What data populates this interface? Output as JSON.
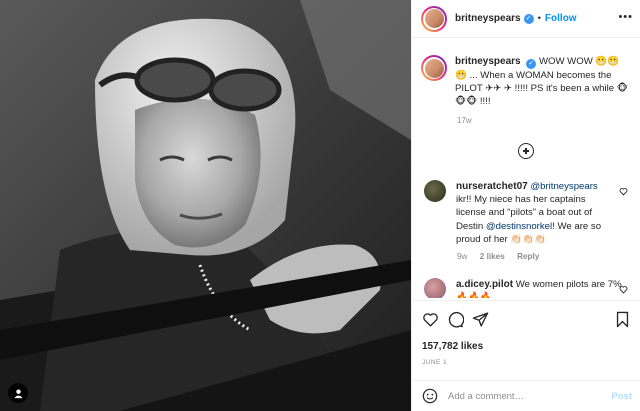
{
  "photo": {
    "alt_icon": "person-tag-icon"
  },
  "header": {
    "username": "britneyspears",
    "verified_glyph": "✓",
    "separator": "•",
    "follow_label": "Follow",
    "more_glyph": "•••"
  },
  "caption": {
    "username": "britneyspears",
    "text": "WOW WOW 😬😬😬 ... When a WOMAN becomes the PILOT ✈✈ ✈ !!!!! PS it's been a while 🐵🐵🐵 !!!!",
    "time": "17w"
  },
  "comments": [
    {
      "username": "nurseratchet07",
      "mention1": "@britneyspears",
      "text1": "ikr!! My niece has her captains license and “pilots” a boat out of Destin",
      "mention2": "@destinsnorkel",
      "text2": "! We are so proud of her 👏🏻👏🏻👏🏻",
      "time": "9w",
      "likes": "2 likes",
      "reply": "Reply"
    },
    {
      "username": "a.dicey.pilot",
      "text": "We women pilots are 7% 🔥🔥🔥"
    }
  ],
  "actions": {
    "likes": "157,782 likes",
    "date": "JUNE 1"
  },
  "add_comment": {
    "placeholder": "Add a comment…",
    "post_label": "Post"
  },
  "colors": {
    "accent": "#0095f6",
    "verified": "#3897f0",
    "muted": "#8e8e8e",
    "post_disabled": "#b2dffc"
  }
}
